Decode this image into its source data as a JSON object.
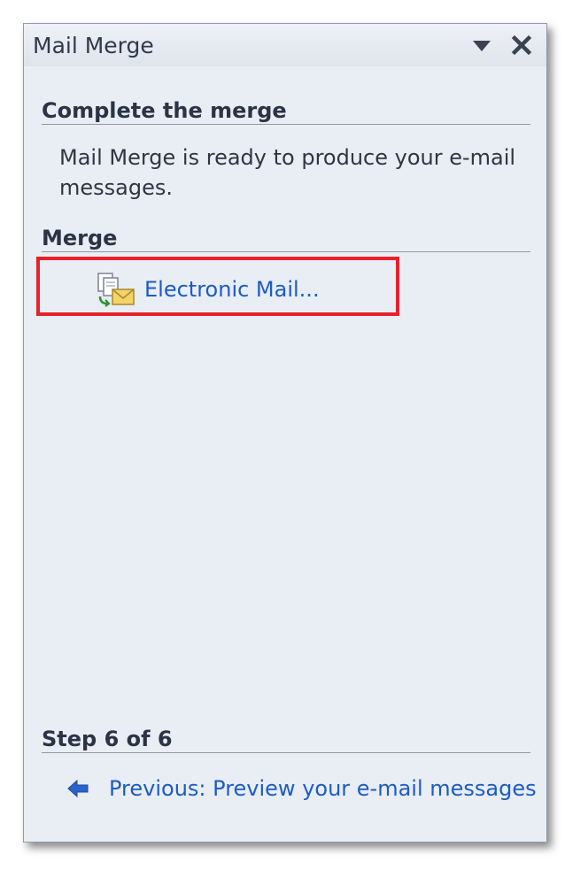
{
  "pane": {
    "title": "Mail Merge",
    "menu_icon": "dropdown-triangle-icon",
    "close_icon": "close-x-icon"
  },
  "complete": {
    "heading": "Complete the merge",
    "description": "Mail Merge is ready to produce your e-mail messages."
  },
  "merge": {
    "heading": "Merge",
    "electronic_mail_label": "Electronic Mail...",
    "electronic_mail_icon": "merge-to-email-icon"
  },
  "step": {
    "heading": "Step 6 of 6",
    "previous_label": "Previous: Preview your e-mail messages",
    "previous_icon": "back-arrow-icon"
  },
  "colors": {
    "pane_background": "#e9edf4",
    "link": "#1b5cc5",
    "highlight_box": "#e8202c"
  }
}
